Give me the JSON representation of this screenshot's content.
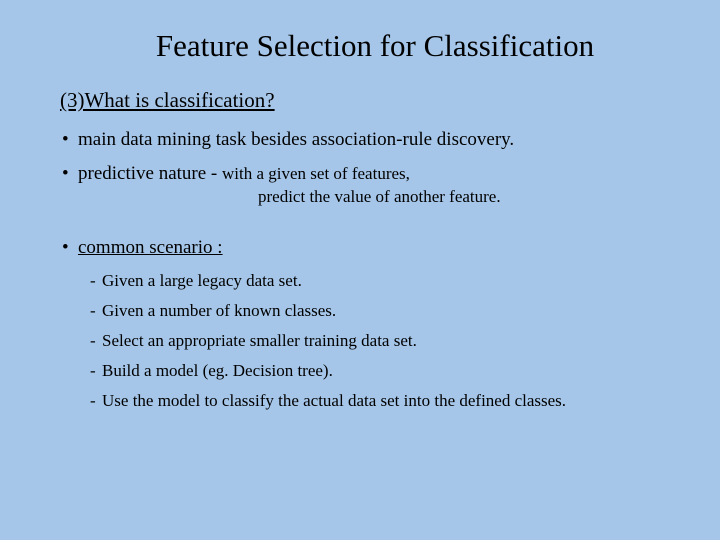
{
  "title": "Feature Selection for Classification",
  "subheading": "(3)What is classification?",
  "bullets": {
    "b1": "main data mining task besides association-rule discovery.",
    "b2a": "predictive nature - ",
    "b2b": "with a given set of features,",
    "b2c": "predict the value of another feature.",
    "b3": "common scenario  :"
  },
  "sub": {
    "s1": "Given a large legacy data set.",
    "s2": "Given a number of known classes.",
    "s3": "Select an appropriate smaller training data set.",
    "s4": "Build a model (eg. Decision tree).",
    "s5": "Use the model to classify the actual data set into the defined classes."
  },
  "glyphs": {
    "dot": "•",
    "dash": "-"
  }
}
